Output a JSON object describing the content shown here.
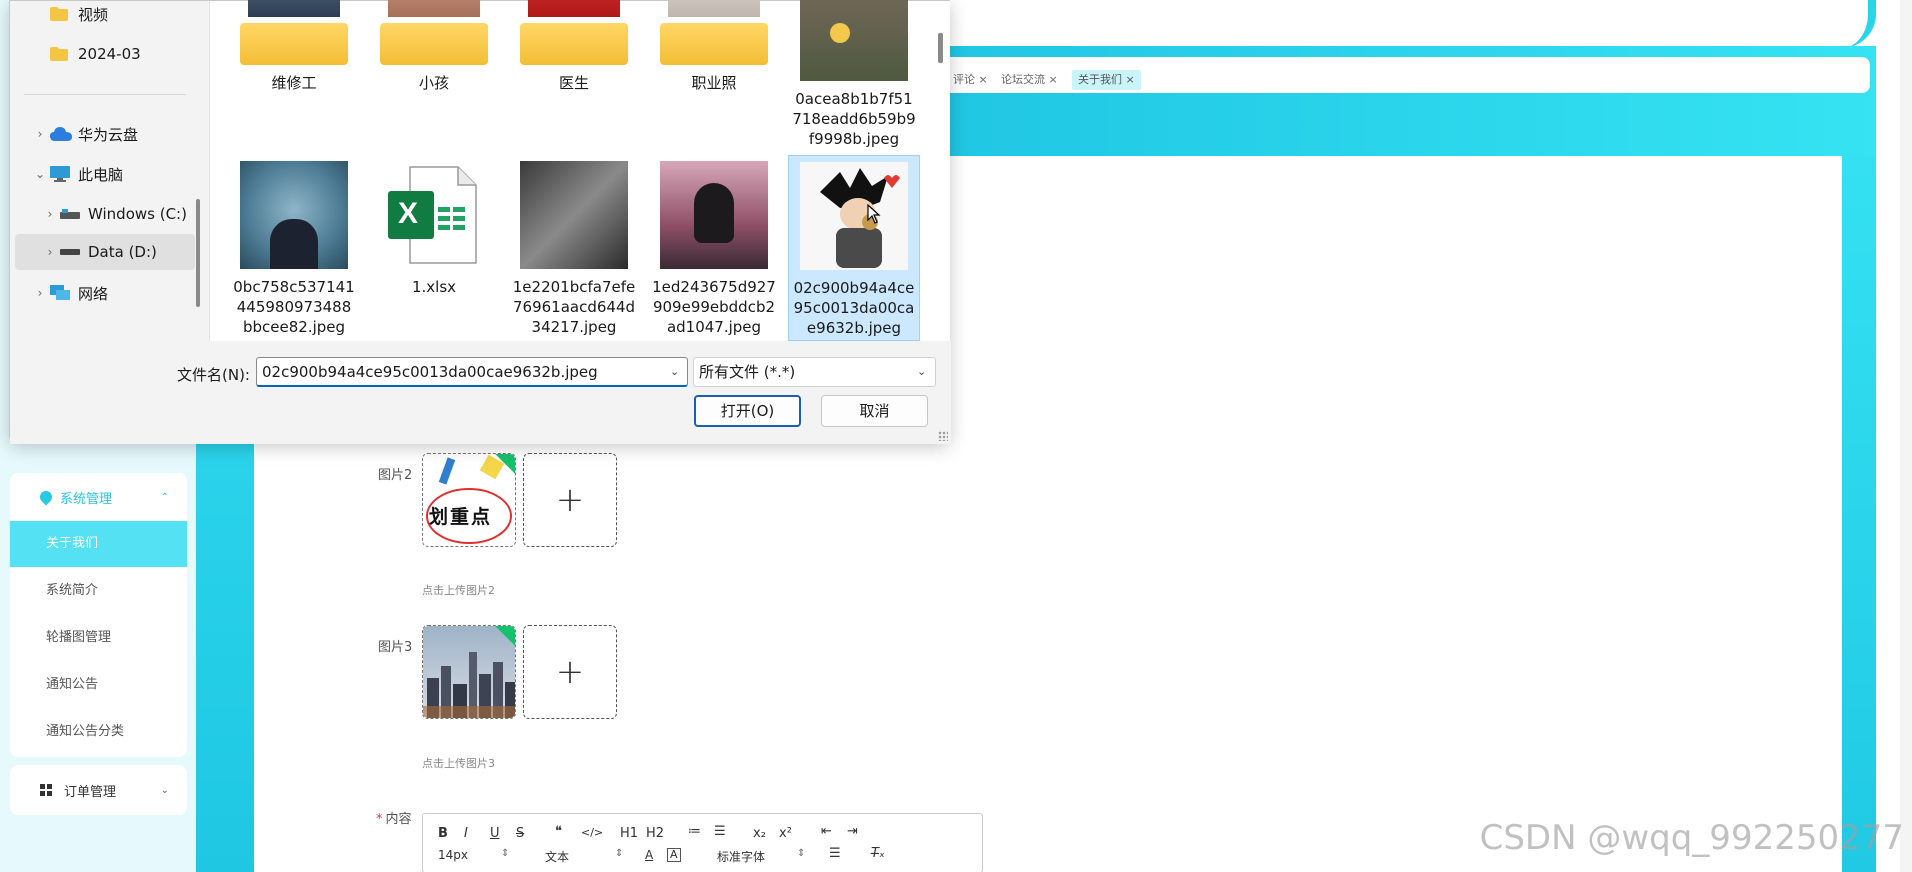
{
  "app": {
    "tabs": [
      "评论 ×",
      "论坛交流 ×",
      "关于我们 ×"
    ],
    "sidebar": {
      "section_title": "系统管理",
      "items": [
        "关于我们",
        "系统简介",
        "轮播图管理",
        "通知公告",
        "通知公告分类"
      ],
      "order_menu": "订单管理"
    },
    "form": {
      "image2_label": "图片2",
      "image2_hint": "点击上传图片2",
      "image2_text": "划重点",
      "image3_label": "图片3",
      "image3_hint": "点击上传图片3",
      "plus": "+",
      "content_label": "内容",
      "required_mark": "*"
    },
    "editor": {
      "row1": [
        "B",
        "I",
        "U",
        "S",
        "❝",
        "</>",
        "H1",
        "H2",
        "≔",
        "☰",
        "x₂",
        "x²",
        "⇤",
        "⇥"
      ],
      "size": "14px",
      "text_style": "文本",
      "font": "标准字体"
    },
    "watermark": "CSDN @wqq_992250277"
  },
  "dialog": {
    "nav": [
      {
        "label": "视频",
        "icon": "folder-icon"
      },
      {
        "label": "2024-03",
        "icon": "folder-icon"
      },
      {
        "label": "华为云盘",
        "icon": "cloud-icon"
      },
      {
        "label": "此电脑",
        "icon": "computer-icon"
      },
      {
        "label": "Windows (C:)",
        "icon": "drive-icon"
      },
      {
        "label": "Data (D:)",
        "icon": "drive-icon"
      },
      {
        "label": "网络",
        "icon": "network-icon"
      }
    ],
    "files_row1": [
      {
        "label": "维修工",
        "type": "folder"
      },
      {
        "label": "小孩",
        "type": "folder"
      },
      {
        "label": "医生",
        "type": "folder"
      },
      {
        "label": "职业照",
        "type": "folder"
      },
      {
        "label": "0acea8b1b7f51718eadd6b59b9f9998b.jpeg",
        "type": "image"
      }
    ],
    "files_row2": [
      {
        "label": "0bc758c537141445980973488bbcee82.jpeg",
        "type": "image"
      },
      {
        "label": "1.xlsx",
        "type": "excel"
      },
      {
        "label": "1e2201bcfa7efe76961aacd644d34217.jpeg",
        "type": "image"
      },
      {
        "label": "1ed243675d927909e99ebddcb2ad1047.jpeg",
        "type": "image"
      },
      {
        "label": "02c900b94a4ce95c0013da00cae9632b.jpeg",
        "type": "image",
        "selected": true
      }
    ],
    "filename_label": "文件名(N):",
    "filename_value": "02c900b94a4ce95c0013da00cae9632b.jpeg",
    "filetype_value": "所有文件 (*.*)",
    "open_button": "打开(O)",
    "cancel_button": "取消",
    "excel_letter": "X"
  }
}
